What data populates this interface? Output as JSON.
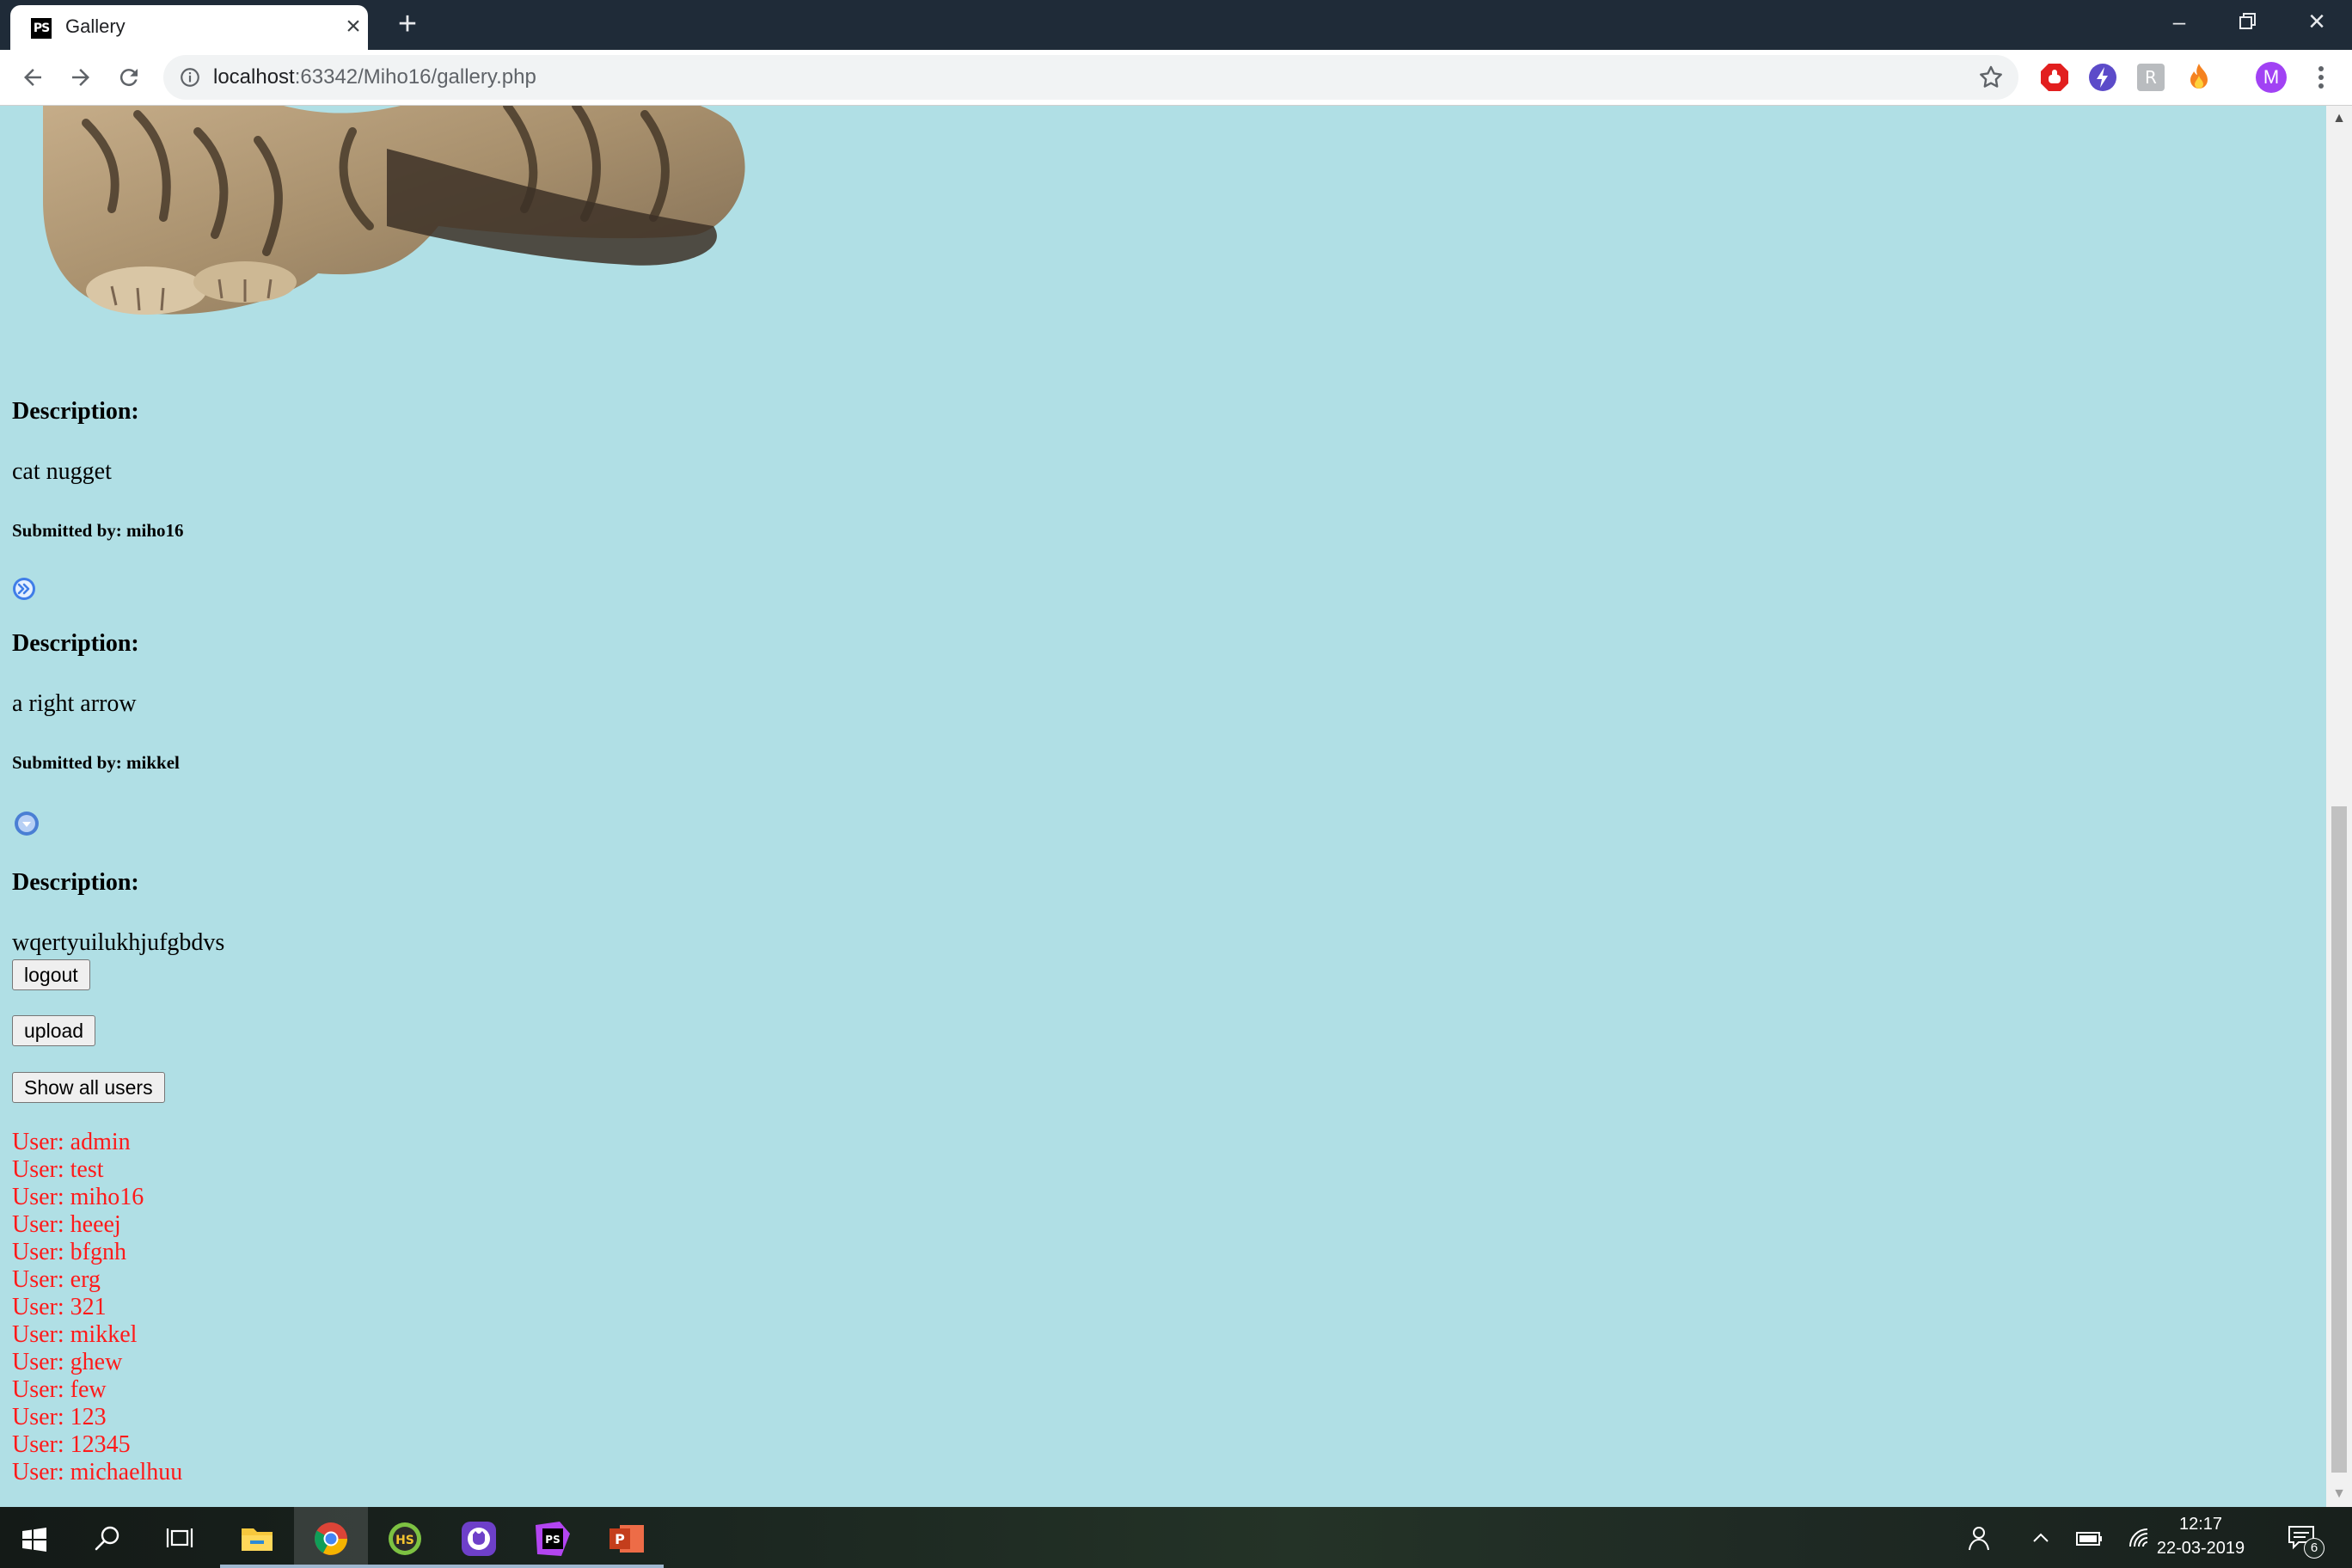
{
  "browser": {
    "tab_title": "Gallery",
    "tab_favicon_text": "PS",
    "url_host": "localhost",
    "url_rest": ":63342/Miho16/gallery.php",
    "profile_initial": "M"
  },
  "entries": [
    {
      "description_heading": "Description:",
      "description": "cat nugget",
      "submitted_by": "Submitted by: miho16"
    },
    {
      "description_heading": "Description:",
      "description": "a right arrow",
      "submitted_by": "Submitted by: mikkel"
    },
    {
      "description_heading": "Description:",
      "description": "wqertyuilukhjufgbdvs"
    }
  ],
  "buttons": {
    "logout": "logout",
    "upload": "upload",
    "show_users": "Show all users"
  },
  "users": [
    "User: admin",
    "User: test",
    "User: miho16",
    "User: heeej",
    "User: bfgnh",
    "User: erg",
    "User: 321",
    "User: mikkel",
    "User: ghew",
    "User: few",
    "User: 123",
    "User: 12345",
    "User: michaelhuu"
  ],
  "taskbar": {
    "time": "12:17",
    "date": "22-03-2019",
    "notification_count": "6",
    "apps": [
      "file-explorer",
      "chrome",
      "hotspot-shield",
      "github-desktop",
      "phpstorm",
      "powerpoint"
    ]
  },
  "colors": {
    "page_background": "#b0dfe5",
    "user_text": "#ff1a1a",
    "titlebar": "#1f2b38"
  }
}
